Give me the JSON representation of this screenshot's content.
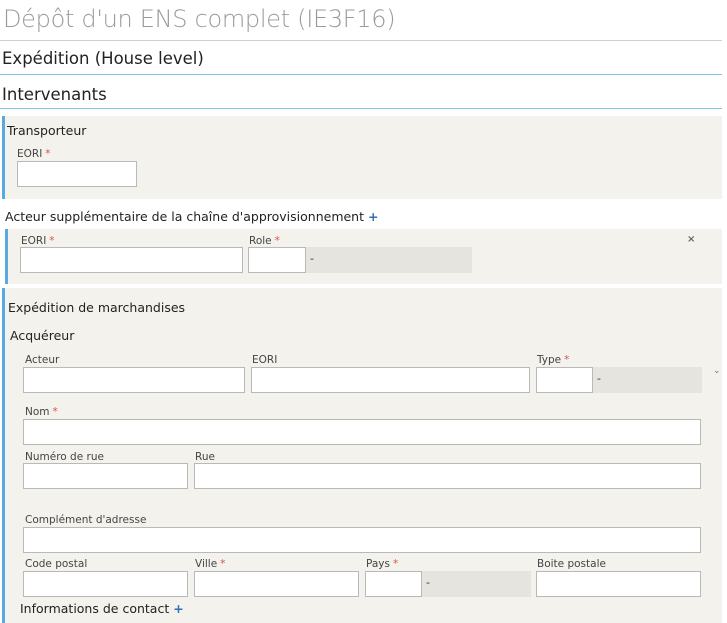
{
  "page": {
    "title": "Dépôt d'un ENS complet (IE3F16)"
  },
  "sections": {
    "expedition_house": "Expédition (House level)",
    "intervenants": "Intervenants"
  },
  "transporteur": {
    "title": "Transporteur",
    "eori_label": "EORI",
    "required_mark": "*"
  },
  "acteur_supp": {
    "title": "Acteur supplémentaire de la chaîne d'approvisionnement",
    "add_icon": "+",
    "eori_label": "EORI",
    "role_label": "Role",
    "role_addon": "-",
    "remove_icon": "×"
  },
  "expedition_marchandises": {
    "title": "Expédition de marchandises",
    "acquereur": {
      "title": "Acquéreur",
      "acteur_label": "Acteur",
      "eori_label": "EORI",
      "type_label": "Type",
      "type_addon": "-",
      "chevron_icon": "⌄",
      "nom_label": "Nom",
      "numero_rue_label": "Numéro de rue",
      "rue_label": "Rue",
      "complement_label": "Complément d'adresse",
      "code_postal_label": "Code postal",
      "ville_label": "Ville",
      "pays_label": "Pays",
      "pays_addon": "-",
      "boite_postale_label": "Boite postale"
    },
    "contact": {
      "title": "Informations de contact",
      "add_icon": "+"
    }
  },
  "colors": {
    "accent_blue": "#5aa9e0",
    "rule_blue": "#7fc4e3",
    "panel_bg": "#f4f2ec",
    "required_red": "#d9534f",
    "plus_blue": "#2f6fb7"
  }
}
